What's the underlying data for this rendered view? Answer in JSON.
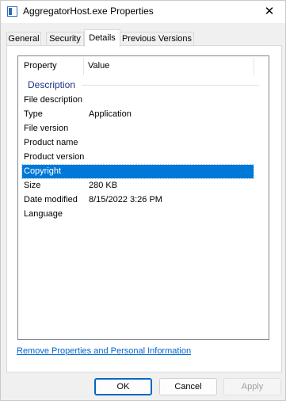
{
  "window": {
    "title": "AggregatorHost.exe Properties",
    "close_glyph": "✕"
  },
  "tabs": [
    {
      "label": "General",
      "active": false
    },
    {
      "label": "Security",
      "active": false
    },
    {
      "label": "Details",
      "active": true
    },
    {
      "label": "Previous Versions",
      "active": false
    }
  ],
  "details": {
    "columns": {
      "property": "Property",
      "value": "Value"
    },
    "group": "Description",
    "rows": [
      {
        "property": "File description",
        "value": ""
      },
      {
        "property": "Type",
        "value": "Application"
      },
      {
        "property": "File version",
        "value": ""
      },
      {
        "property": "Product name",
        "value": ""
      },
      {
        "property": "Product version",
        "value": ""
      },
      {
        "property": "Copyright",
        "value": "",
        "selected": true
      },
      {
        "property": "Size",
        "value": "280 KB"
      },
      {
        "property": "Date modified",
        "value": "8/15/2022 3:26 PM"
      },
      {
        "property": "Language",
        "value": ""
      }
    ]
  },
  "remove_link": "Remove Properties and Personal Information",
  "buttons": {
    "ok": "OK",
    "cancel": "Cancel",
    "apply": "Apply"
  },
  "colors": {
    "selection": "#0078d7",
    "link": "#0066cc",
    "group_label": "#1e3287"
  },
  "icons": {
    "title": "window-properties-icon"
  }
}
